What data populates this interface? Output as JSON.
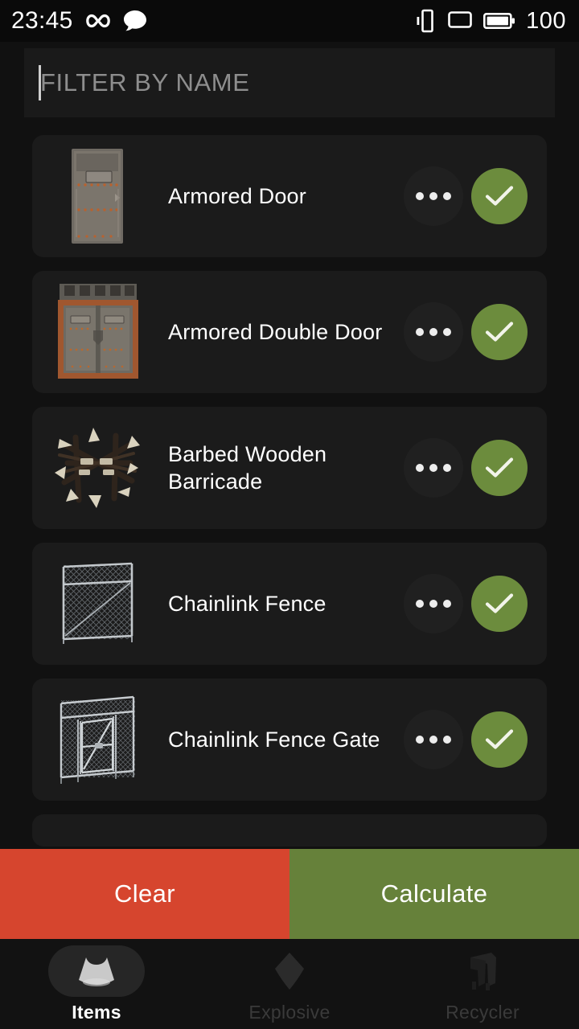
{
  "statusbar": {
    "time": "23:45",
    "battery_level": "100",
    "icons": [
      "infinity-icon",
      "message-bubble-icon",
      "vibrate-icon",
      "cast-screen-icon",
      "battery-full-icon"
    ]
  },
  "filter": {
    "placeholder": "FILTER BY NAME",
    "value": "",
    "caret_visible": true
  },
  "list": {
    "items": [
      {
        "name": "Armored Door",
        "thumbnail": "armored-door-thumbnail",
        "more_label": "...",
        "selected": true
      },
      {
        "name": "Armored Double Door",
        "thumbnail": "armored-double-door-thumbnail",
        "more_label": "...",
        "selected": true
      },
      {
        "name": "Barbed Wooden Barricade",
        "thumbnail": "barbed-wooden-barricade-thumbnail",
        "more_label": "...",
        "selected": true
      },
      {
        "name": "Chainlink Fence",
        "thumbnail": "chainlink-fence-thumbnail",
        "more_label": "...",
        "selected": true
      },
      {
        "name": "Chainlink Fence Gate",
        "thumbnail": "chainlink-fence-gate-thumbnail",
        "more_label": "...",
        "selected": true
      }
    ]
  },
  "actions": {
    "clear_label": "Clear",
    "calculate_label": "Calculate",
    "clear_color": "#d6452e",
    "calculate_color": "#66813a"
  },
  "bottomnav": {
    "items": [
      {
        "label": "Items",
        "icon": "sleeping-bag-icon",
        "active": true
      },
      {
        "label": "Explosive",
        "icon": "explosive-diamond-icon",
        "active": false
      },
      {
        "label": "Recycler",
        "icon": "recycler-machine-icon",
        "active": false
      }
    ]
  },
  "theme": {
    "page_bg": "#111111",
    "card_bg": "#1b1b1b",
    "accent_green": "#6c8c3d",
    "accent_red": "#d6452e",
    "text_primary": "#ffffff",
    "text_muted": "#8e8e8e"
  }
}
